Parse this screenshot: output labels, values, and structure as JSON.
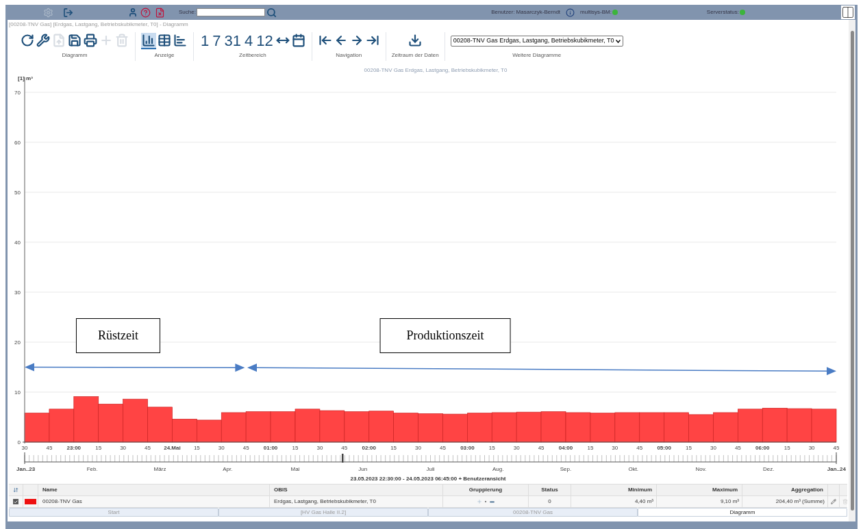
{
  "top_bar": {
    "search_label": "Suche:",
    "user": "Benutzer: Masarczyk-Berndt",
    "indicators": [
      {
        "label": "multisys-BM:",
        "color": "#3cb43c"
      },
      {
        "label": "Serverstatus:",
        "color": "#3cb43c"
      }
    ]
  },
  "window": {
    "title": "[00208-TNV Gas] [Erdgas, Lastgang, Betriebskubikmeter, T0] - Diagramm"
  },
  "toolbar": [
    {
      "label": "Diagramm",
      "buttons": [
        {
          "kind": "refresh",
          "disabled": false
        },
        {
          "kind": "settings",
          "disabled": false
        },
        {
          "kind": "export",
          "disabled": true
        },
        {
          "kind": "save",
          "disabled": false
        },
        {
          "kind": "print",
          "disabled": false
        },
        {
          "kind": "add",
          "disabled": true
        },
        {
          "kind": "delete",
          "disabled": true
        }
      ]
    },
    {
      "label": "Anzeige",
      "buttons": [
        {
          "kind": "chart",
          "selected": true
        },
        {
          "kind": "table",
          "selected": false
        },
        {
          "kind": "columns",
          "selected": false
        }
      ]
    },
    {
      "label": "Zeitbereich",
      "buttons": [
        {
          "kind": "text",
          "text": "1"
        },
        {
          "kind": "text",
          "text": "7"
        },
        {
          "kind": "text",
          "text": "31"
        },
        {
          "kind": "text",
          "text": "4"
        },
        {
          "kind": "text",
          "text": "12"
        },
        {
          "kind": "fit"
        },
        {
          "kind": "calendar"
        }
      ]
    },
    {
      "label": "Navigation",
      "buttons": [
        {
          "kind": "first"
        },
        {
          "kind": "prev"
        },
        {
          "kind": "next"
        },
        {
          "kind": "last"
        }
      ]
    },
    {
      "label": "Zeitraum der Daten",
      "buttons": [
        {
          "kind": "download"
        }
      ]
    },
    {
      "label": "Weitere Diagramme",
      "select": "00208-TNV Gas Erdgas, Lastgang, Betriebskubikmeter, T0"
    }
  ],
  "chart": {
    "chart_data": {
      "type": "bar",
      "title": "00208-TNV Gas Erdgas, Lastgang, Betriebskubikmeter, T0",
      "ylabel": "[1] m³",
      "categories": [
        "30",
        "45",
        "23:00",
        "15",
        "30",
        "45",
        "24.Mai",
        "15",
        "30",
        "45",
        "01:00",
        "15",
        "30",
        "45",
        "02:00",
        "15",
        "30",
        "45",
        "03:00",
        "15",
        "30",
        "45",
        "04:00",
        "15",
        "30",
        "45",
        "05:00",
        "15",
        "30",
        "45",
        "06:00",
        "15",
        "30"
      ],
      "values": [
        5.8,
        6.6,
        9.1,
        7.6,
        8.6,
        7.0,
        4.6,
        4.4,
        5.9,
        6.1,
        6.1,
        6.6,
        6.3,
        6.1,
        6.2,
        5.8,
        5.7,
        5.6,
        5.8,
        5.9,
        6.0,
        6.1,
        5.9,
        5.8,
        5.9,
        5.9,
        5.9,
        5.5,
        5.9,
        6.6,
        6.8,
        6.7,
        6.6
      ],
      "ylim": [
        0,
        73
      ],
      "grid": true,
      "yticks": [
        0,
        10,
        20,
        30,
        40,
        50,
        60,
        70
      ],
      "annotations": [
        "Rüstzeit",
        "Produktionszeit"
      ]
    },
    "category_bold": [
      false,
      false,
      true,
      false,
      false,
      false,
      true,
      false,
      false,
      false,
      true,
      false,
      false,
      false,
      true,
      false,
      false,
      false,
      true,
      false,
      false,
      false,
      true,
      false,
      false,
      false,
      true,
      false,
      false,
      false,
      true,
      false,
      false
    ],
    "axis_end_label": "45",
    "navigator": {
      "labels": [
        "Jan..23",
        "Feb.",
        "März",
        "Apr.",
        "Mai",
        "Jun",
        "Juli",
        "Aug.",
        "Sep.",
        "Okt.",
        "Nov.",
        "Dez.",
        "Jan..24"
      ]
    },
    "range": "23.05.2023 22:30:00 - 24.05.2023 06:45:00 + Benutzeransicht"
  },
  "table": {
    "columns": [
      "Name",
      "OBIS",
      "Gruppierung",
      "Status",
      "Minimum",
      "Maximum",
      "Aggregation"
    ],
    "rows": [
      {
        "checked": true,
        "color": "#ee1111",
        "name": "00208-TNV Gas",
        "obis": "Erdgas, Lastgang, Betriebskubikmeter, T0",
        "status": "0",
        "minimum": "4,40 m³",
        "maximum": "9,10 m³",
        "aggregation": "204,40 m³ (Summe)"
      }
    ]
  },
  "tabs": [
    {
      "label": "Start",
      "selected": false
    },
    {
      "label": "[HV Gas Halle II.2]",
      "selected": false
    },
    {
      "label": "00208-TNV Gas",
      "selected": false
    },
    {
      "label": "Diagramm",
      "selected": true
    }
  ]
}
